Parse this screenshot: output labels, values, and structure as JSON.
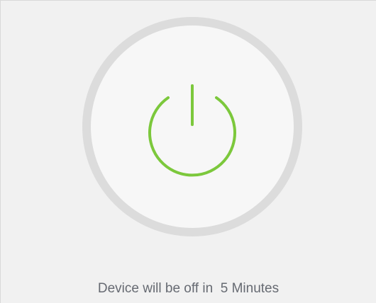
{
  "power": {
    "icon": "power-icon",
    "accent_color": "#7cc83c"
  },
  "status": {
    "prefix": "Device will be off in  ",
    "value": "5",
    "unit": " Minutes"
  }
}
